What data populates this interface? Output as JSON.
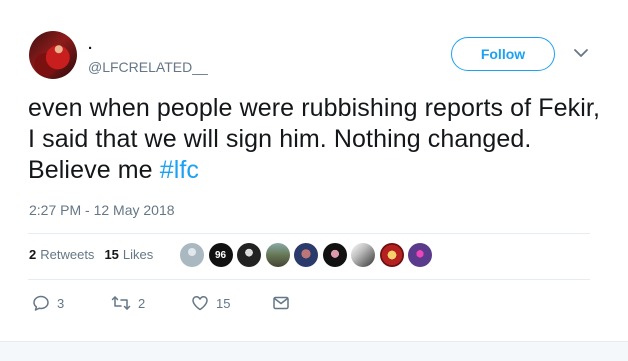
{
  "author": {
    "display_name": ".",
    "handle": "@LFCRELATED__"
  },
  "follow_label": "Follow",
  "tweet": {
    "text": "even when people were rubbishing reports of Fekir, I said that we will sign him. Nothing changed. Believe me ",
    "hashtag": "#lfc",
    "timestamp": "2:27 PM - 12 May 2018"
  },
  "stats": {
    "retweets_count": "2",
    "retweets_label": "Retweets",
    "likes_count": "15",
    "likes_label": "Likes"
  },
  "likers_badge_text": "96",
  "actions": {
    "reply_count": "3",
    "retweet_count": "2",
    "like_count": "15"
  },
  "colors": {
    "accent": "#1da1f2",
    "secondary_text": "#657786",
    "primary_text": "#14171a"
  }
}
